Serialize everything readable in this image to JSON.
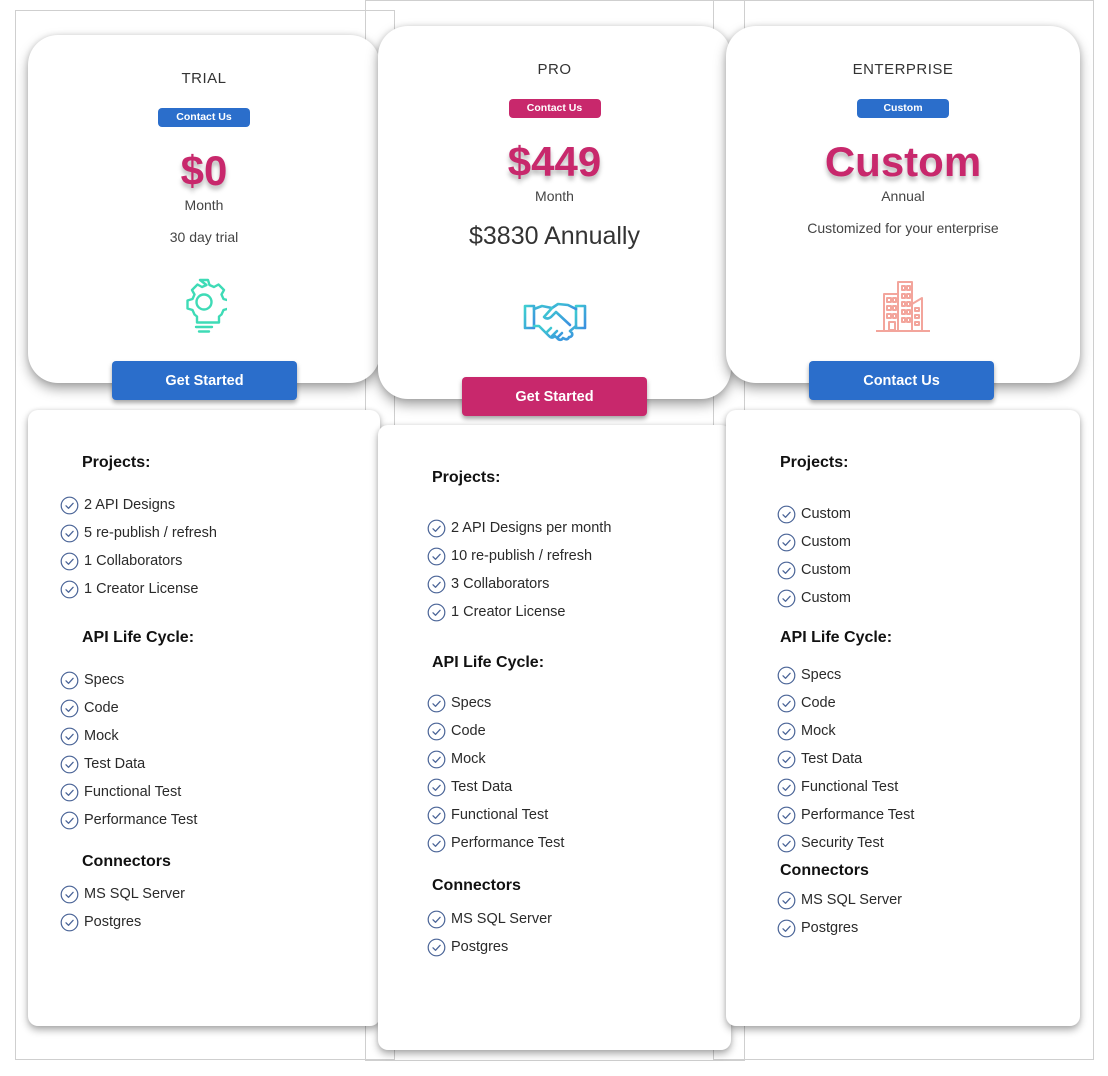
{
  "colors": {
    "blue": "#2b6ecb",
    "magenta": "#c8286c",
    "teal_icon": "#3edbb6",
    "handshake_start": "#3fd0d0",
    "handshake_end": "#3b8fe0",
    "building_icon": "#f3a59c",
    "check_icon": "#4a6497"
  },
  "plans": [
    {
      "name": "TRIAL",
      "badge": "Contact Us",
      "badge_color": "blue",
      "price": "$0",
      "period": "Month",
      "subtext": "30 day trial",
      "icon": "gear-bulb-icon",
      "cta": "Get Started",
      "cta_color": "blue",
      "sections": [
        {
          "heading": "Projects:",
          "items": [
            "2 API Designs",
            "5 re-publish / refresh",
            "1  Collaborators",
            "1 Creator License"
          ]
        },
        {
          "heading": "API Life Cycle:",
          "items": [
            "Specs",
            "Code",
            "Mock",
            "Test Data",
            "Functional Test",
            "Performance Test"
          ]
        },
        {
          "heading": "Connectors",
          "items": [
            "MS SQL Server",
            "Postgres"
          ]
        }
      ]
    },
    {
      "name": "PRO",
      "badge": "Contact Us",
      "badge_color": "magenta",
      "price": "$449",
      "period": "Month",
      "subtext": "$3830 Annually",
      "icon": "handshake-icon",
      "cta": "Get Started",
      "cta_color": "magenta",
      "sections": [
        {
          "heading": "Projects:",
          "items": [
            "2 API Designs per month",
            "10 re-publish / refresh",
            "3 Collaborators",
            "1 Creator License"
          ]
        },
        {
          "heading": "API Life Cycle:",
          "items": [
            "Specs",
            "Code",
            "Mock",
            "Test Data",
            "Functional Test",
            "Performance Test"
          ]
        },
        {
          "heading": "Connectors",
          "items": [
            "MS SQL Server",
            "Postgres"
          ]
        }
      ]
    },
    {
      "name": "ENTERPRISE",
      "badge": "Custom",
      "badge_color": "blue",
      "price": "Custom",
      "period": "Annual",
      "subtext": "Customized for your enterprise",
      "icon": "building-icon",
      "cta": "Contact Us",
      "cta_color": "blue",
      "sections": [
        {
          "heading": "Projects:",
          "items": [
            "Custom",
            "Custom",
            "Custom",
            "Custom"
          ]
        },
        {
          "heading": "API Life Cycle:",
          "items": [
            "Specs",
            "Code",
            "Mock",
            "Test Data",
            "Functional Test",
            "Performance Test",
            "Security Test"
          ]
        },
        {
          "heading": "Connectors",
          "items": [
            "MS SQL Server",
            "Postgres"
          ]
        }
      ]
    }
  ]
}
